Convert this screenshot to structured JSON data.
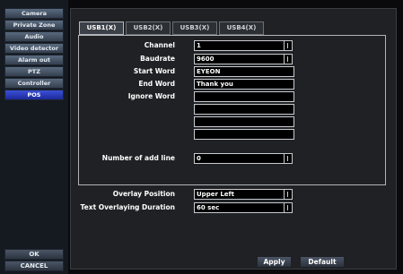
{
  "sidebar": {
    "items": [
      {
        "label": "Camera"
      },
      {
        "label": "Private Zone"
      },
      {
        "label": "Audio"
      },
      {
        "label": "Video detector"
      },
      {
        "label": "Alarm out"
      },
      {
        "label": "PTZ"
      },
      {
        "label": "Controller"
      },
      {
        "label": "POS"
      }
    ],
    "active": "POS",
    "ok_label": "OK",
    "cancel_label": "CANCEL"
  },
  "tabs": [
    {
      "label": "USB1(X)",
      "active": true
    },
    {
      "label": "USB2(X)",
      "active": false
    },
    {
      "label": "USB3(X)",
      "active": false
    },
    {
      "label": "USB4(X)",
      "active": false
    }
  ],
  "settings": {
    "channel": {
      "label": "Channel",
      "value": "1"
    },
    "baudrate": {
      "label": "Baudrate",
      "value": "9600"
    },
    "start_word": {
      "label": "Start Word",
      "value": "EYEON"
    },
    "end_word": {
      "label": "End Word",
      "value": "Thank  you"
    },
    "ignore_word": {
      "label": "Ignore Word",
      "values": [
        "",
        "",
        "",
        ""
      ]
    },
    "add_lines": {
      "label": "Number of add line",
      "value": "0"
    }
  },
  "overlay": {
    "position": {
      "label": "Overlay Position",
      "value": "Upper Left"
    },
    "duration": {
      "label": "Text Overlaying Duration",
      "value": "60 sec"
    }
  },
  "actions": {
    "apply_label": "Apply",
    "default_label": "Default"
  },
  "colors": {
    "active_tab_bg": "#3c4048",
    "active_side_bg": "#2a3cc0",
    "panel_bg": "#1f2124"
  }
}
